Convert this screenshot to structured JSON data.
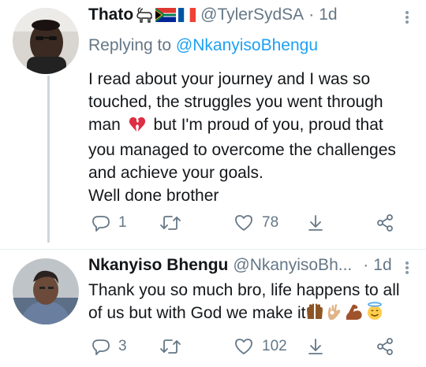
{
  "tweet1": {
    "display_name": "Thato",
    "handle": "@TylerSydSA",
    "separator": "·",
    "time": "1d",
    "replying_prefix": "Replying to",
    "replying_handle": "@NkanyisoBhengu",
    "lines": [
      "I read about your journey and I was so",
      "touched, the struggles you went through",
      "man",
      "but I'm proud of you, proud that",
      "you managed to overcome the challenges",
      "and achieve your goals.",
      "Well done brother"
    ],
    "name_emojis": [
      "goat-emoji",
      "south-africa-flag",
      "france-flag"
    ],
    "inline_emoji": "broken-heart-emoji",
    "replies": "1",
    "retweets": "",
    "likes": "78"
  },
  "tweet2": {
    "display_name": "Nkanyiso Bhengu",
    "handle": "@NkanyisoBh...",
    "separator": "·",
    "time": "1d",
    "lines": [
      "Thank you so much bro, life happens to all",
      "of us but with God we make it"
    ],
    "trailing_emojis": [
      "raised-hands-emoji",
      "ok-hand-emoji",
      "flexed-biceps-emoji",
      "smiling-face-with-halo-emoji"
    ],
    "replies": "3",
    "retweets": "",
    "likes": "102"
  },
  "colors": {
    "text": "#14171a",
    "secondary": "#657786",
    "link": "#1da1f2",
    "thread_line": "#ccd6dd",
    "divider": "#e6ecf0"
  },
  "icons": [
    "reply-icon",
    "retweet-icon",
    "like-icon",
    "share-icon",
    "more-icon"
  ]
}
